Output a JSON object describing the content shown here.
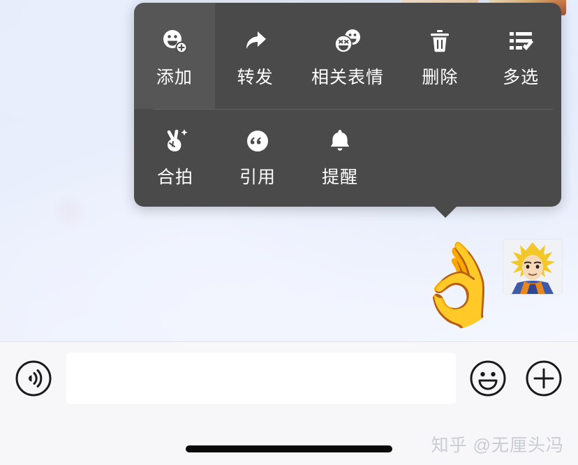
{
  "theme": {
    "menu_bg": "#4a4a4a",
    "menu_text": "#ffffff",
    "wallpaper_start": "#e6ecfb",
    "wallpaper_end": "#f4f7fe",
    "input_bar_bg": "#f7f7f9",
    "watermark_color": "#c9ccd4"
  },
  "context_menu": {
    "rows": [
      {
        "items": [
          {
            "label": "添加",
            "icon": "smiley-plus-icon",
            "highlighted": true
          },
          {
            "label": "转发",
            "icon": "forward-arrow-icon",
            "highlighted": false
          },
          {
            "label": "相关表情",
            "icon": "double-smiley-icon",
            "highlighted": false
          },
          {
            "label": "删除",
            "icon": "trash-icon",
            "highlighted": false
          },
          {
            "label": "多选",
            "icon": "list-check-icon",
            "highlighted": false
          }
        ]
      },
      {
        "items": [
          {
            "label": "合拍",
            "icon": "hand-sparkle-icon",
            "highlighted": false
          },
          {
            "label": "引用",
            "icon": "quote-icon",
            "highlighted": false
          },
          {
            "label": "提醒",
            "icon": "bell-icon",
            "highlighted": false
          }
        ]
      }
    ]
  },
  "chat": {
    "sticker_ok_hand": "👌",
    "avatar_name": "goku-avatar",
    "top_thumbnails": [
      "sticker-thumbnail-1",
      "sticker-thumbnail-2"
    ]
  },
  "input_bar": {
    "voice_icon": "voice-wave-icon",
    "message_value": "",
    "message_placeholder": "",
    "emoji_icon": "smiley-icon",
    "plus_icon": "plus-icon"
  },
  "watermark": {
    "text": "知乎 @无厘头冯"
  }
}
